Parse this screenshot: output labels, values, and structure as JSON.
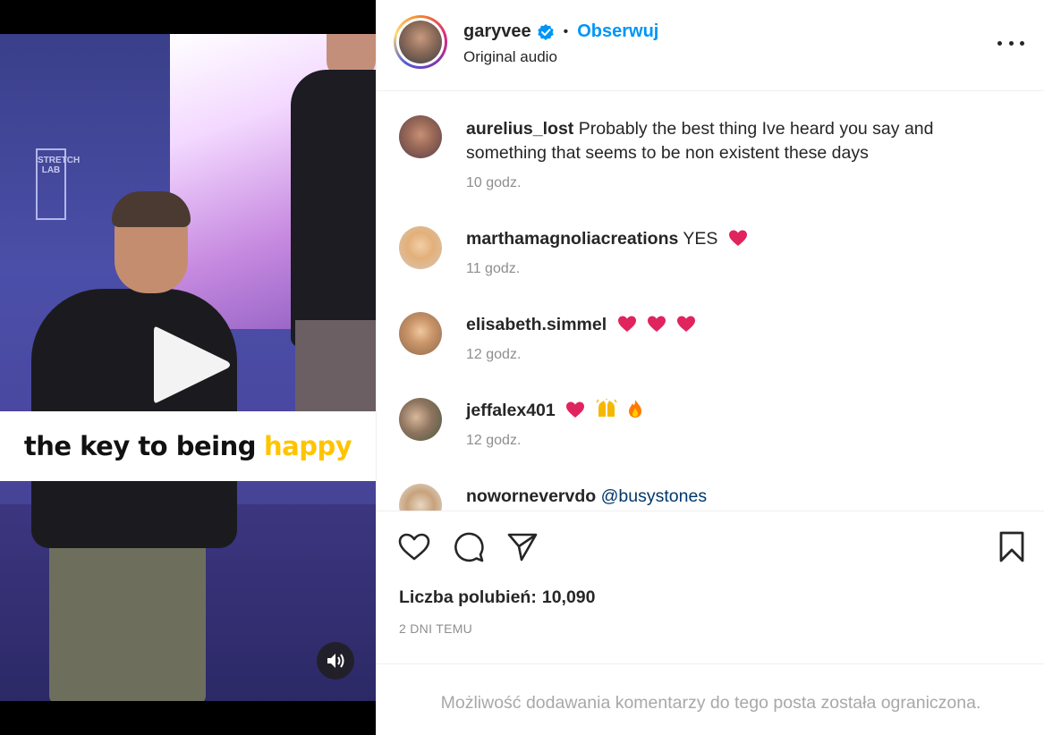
{
  "media": {
    "caption_main": "the key to being",
    "caption_accent": "happy",
    "caption_accent_color": "#ffc400",
    "stage_logo_text": "STRETCH LAB",
    "play_icon": "play-icon",
    "audio_icon": "speaker-icon"
  },
  "header": {
    "username": "garyvee",
    "verified_icon": "verified-badge-icon",
    "separator": "•",
    "follow_label": "Obserwuj",
    "follow_color": "#0095f6",
    "audio_label": "Original audio",
    "more_icon": "more-options-icon"
  },
  "comments": [
    {
      "username": "aurelius_lost",
      "text": "Probably the best thing Ive heard you say and something that seems to be non existent these days",
      "time": "10 godz."
    },
    {
      "username": "marthamagnoliacreations",
      "text": "YES",
      "emoji": [
        "❤️"
      ],
      "time": "11 godz."
    },
    {
      "username": "elisabeth.simmel",
      "text": "",
      "emoji": [
        "❤️",
        "❤️",
        "❤️"
      ],
      "time": "12 godz."
    },
    {
      "username": "jeffalex401",
      "text": "",
      "emoji": [
        "❤️",
        "🙌",
        "🔥"
      ],
      "time": "12 godz."
    },
    {
      "username": "nowornevervdo",
      "mention": "@busystones",
      "time": ""
    }
  ],
  "actions": {
    "like_icon": "heart-icon",
    "comment_icon": "comment-icon",
    "share_icon": "send-icon",
    "save_icon": "bookmark-icon",
    "likes_label": "Liczba polubień:",
    "likes_count": "10,090",
    "posted_ago": "2 DNI TEMU"
  },
  "footer": {
    "restricted_notice": "Możliwość dodawania komentarzy do tego posta została ograniczona."
  }
}
